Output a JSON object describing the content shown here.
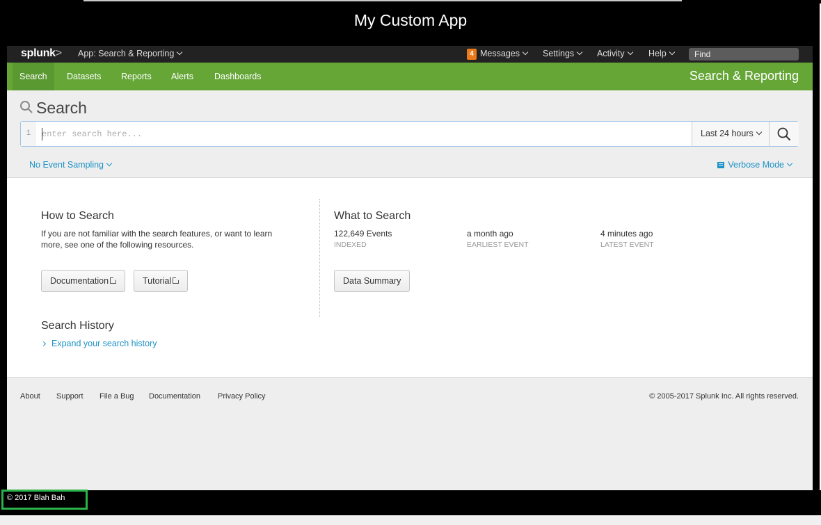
{
  "window": {
    "title": "My Custom App",
    "bottom_copyright": "© 2017 Blah Bah"
  },
  "splunk_bar": {
    "logo": "splunk",
    "logo_suffix": ">",
    "app_menu": "App: Search & Reporting",
    "messages_count": "4",
    "messages": "Messages",
    "settings": "Settings",
    "activity": "Activity",
    "help": "Help",
    "find_placeholder": "Find"
  },
  "app_bar": {
    "tabs": [
      {
        "label": "Search",
        "active": true
      },
      {
        "label": "Datasets"
      },
      {
        "label": "Reports"
      },
      {
        "label": "Alerts"
      },
      {
        "label": "Dashboards"
      }
    ],
    "app_label": "Search & Reporting"
  },
  "search": {
    "heading": "Search",
    "line_number": "1",
    "placeholder": "enter search here...",
    "value": "",
    "time_range": "Last 24 hours",
    "sampling": "No Event Sampling",
    "mode": "Verbose Mode"
  },
  "how_to": {
    "title": "How to Search",
    "description_1": "If you are not familiar with the search features, or want to learn",
    "description_2": "more, see one of the following resources.",
    "documentation_button": "Documentation",
    "tutorial_button": "Tutorial"
  },
  "what_to": {
    "title": "What to Search",
    "stats": [
      {
        "value": "122,649 Events",
        "label": "INDEXED"
      },
      {
        "value": "a month ago",
        "label": "EARLIEST EVENT"
      },
      {
        "value": "4 minutes ago",
        "label": "LATEST EVENT"
      }
    ],
    "data_summary_button": "Data Summary"
  },
  "history": {
    "title": "Search History",
    "expand_link": "Expand your search history"
  },
  "footer": {
    "links": [
      "About",
      "Support",
      "File a Bug",
      "Documentation",
      "Privacy Policy"
    ],
    "copyright": "© 2005-2017 Splunk Inc. All rights reserved."
  },
  "colors": {
    "green_bar": "#65a637",
    "badge": "#ec7a1a",
    "link": "#1e93c6",
    "highlight_box": "#2bb34a"
  }
}
